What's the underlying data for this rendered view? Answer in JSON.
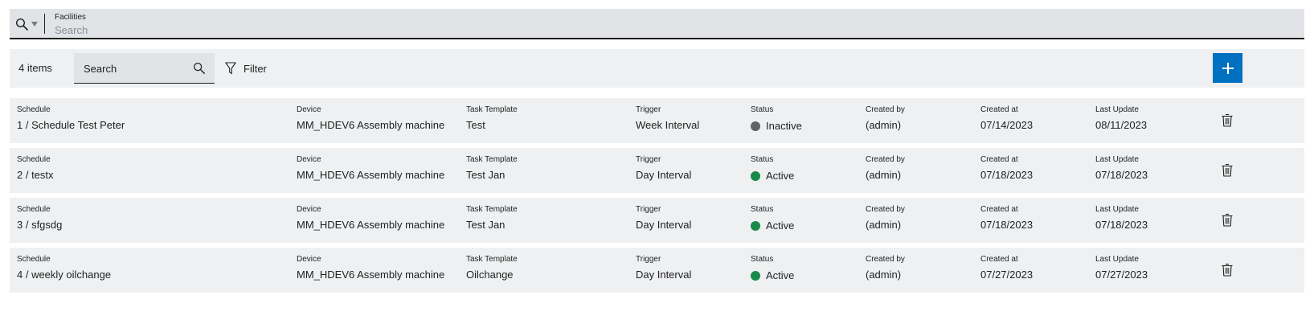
{
  "facilities": {
    "label": "Facilities",
    "placeholder": "Search"
  },
  "toolbar": {
    "count": "4 items",
    "search_placeholder": "Search",
    "filter_label": "Filter"
  },
  "columns": {
    "schedule": "Schedule",
    "device": "Device",
    "task_template": "Task Template",
    "trigger": "Trigger",
    "status": "Status",
    "created_by": "Created by",
    "created_at": "Created at",
    "last_update": "Last Update"
  },
  "colors": {
    "accent": "#0070c0",
    "active": "#1a8a4a",
    "inactive": "#5f6368"
  },
  "rows": [
    {
      "schedule": "1 / Schedule Test Peter",
      "device": "MM_HDEV6 Assembly machine",
      "task_template": "Test",
      "trigger": "Week Interval",
      "status": "Inactive",
      "status_color": "#5f6368",
      "created_by": "(admin)",
      "created_at": "07/14/2023",
      "last_update": "08/11/2023"
    },
    {
      "schedule": "2 / testx",
      "device": "MM_HDEV6 Assembly machine",
      "task_template": "Test Jan",
      "trigger": "Day Interval",
      "status": "Active",
      "status_color": "#1a8a4a",
      "created_by": "(admin)",
      "created_at": "07/18/2023",
      "last_update": "07/18/2023"
    },
    {
      "schedule": "3 / sfgsdg",
      "device": "MM_HDEV6 Assembly machine",
      "task_template": "Test Jan",
      "trigger": "Day Interval",
      "status": "Active",
      "status_color": "#1a8a4a",
      "created_by": "(admin)",
      "created_at": "07/18/2023",
      "last_update": "07/18/2023"
    },
    {
      "schedule": "4 / weekly oilchange",
      "device": "MM_HDEV6 Assembly machine",
      "task_template": "Oilchange",
      "trigger": "Day Interval",
      "status": "Active",
      "status_color": "#1a8a4a",
      "created_by": "(admin)",
      "created_at": "07/27/2023",
      "last_update": "07/27/2023"
    }
  ]
}
